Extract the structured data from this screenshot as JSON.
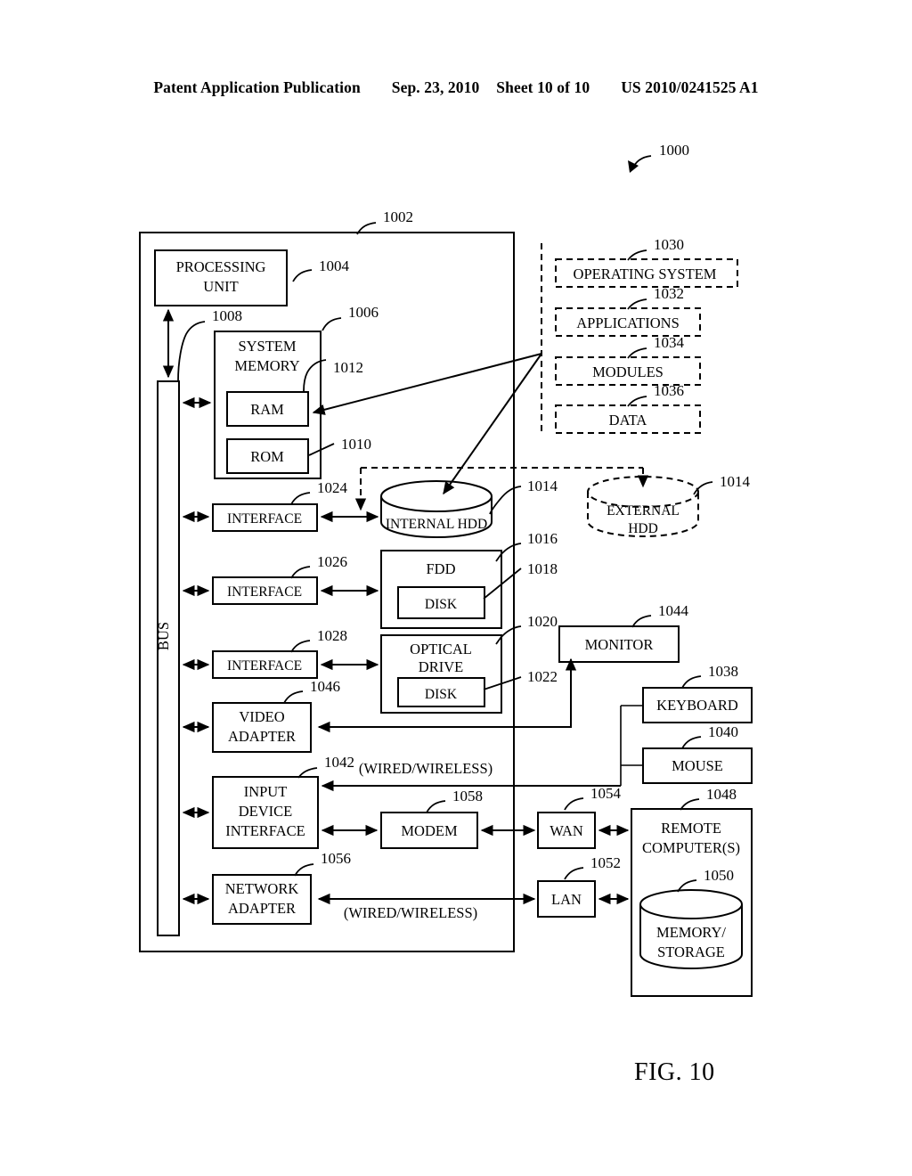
{
  "header": {
    "publication": "Patent Application Publication",
    "date": "Sep. 23, 2010",
    "sheet": "Sheet 10 of 10",
    "patent_number": "US 2010/0241525 A1"
  },
  "figure": {
    "caption": "FIG. 10",
    "system_ref": "1000"
  },
  "blocks": {
    "computer": {
      "ref": "1002"
    },
    "processing_unit": {
      "label_line1": "PROCESSING",
      "label_line2": "UNIT",
      "ref": "1004"
    },
    "system_memory": {
      "label_line1": "SYSTEM",
      "label_line2": "MEMORY",
      "ref": "1006"
    },
    "bus": {
      "label": "BUS",
      "ref": "1008"
    },
    "rom": {
      "label": "ROM",
      "ref": "1010"
    },
    "ram": {
      "label": "RAM",
      "ref": "1012"
    },
    "internal_hdd": {
      "label": "INTERNAL HDD",
      "ref": "1014"
    },
    "external_hdd": {
      "label_line1": "EXTERNAL",
      "label_line2": "HDD",
      "ref": "1014"
    },
    "fdd": {
      "label": "FDD",
      "ref": "1016"
    },
    "fdd_disk": {
      "label": "DISK",
      "ref": "1018"
    },
    "optical_drive": {
      "label_line1": "OPTICAL",
      "label_line2": "DRIVE",
      "ref": "1020"
    },
    "optical_disk": {
      "label": "DISK",
      "ref": "1022"
    },
    "interface_hdd": {
      "label": "INTERFACE",
      "ref": "1024"
    },
    "interface_fdd": {
      "label": "INTERFACE",
      "ref": "1026"
    },
    "interface_optical": {
      "label": "INTERFACE",
      "ref": "1028"
    },
    "operating_system": {
      "label": "OPERATING SYSTEM",
      "ref": "1030"
    },
    "applications": {
      "label": "APPLICATIONS",
      "ref": "1032"
    },
    "modules": {
      "label": "MODULES",
      "ref": "1034"
    },
    "data": {
      "label": "DATA",
      "ref": "1036"
    },
    "keyboard": {
      "label": "KEYBOARD",
      "ref": "1038"
    },
    "mouse": {
      "label": "MOUSE",
      "ref": "1040"
    },
    "input_device_interface": {
      "label_line1": "INPUT",
      "label_line2": "DEVICE",
      "label_line3": "INTERFACE",
      "ref": "1042"
    },
    "monitor": {
      "label": "MONITOR",
      "ref": "1044"
    },
    "video_adapter": {
      "label_line1": "VIDEO",
      "label_line2": "ADAPTER",
      "ref": "1046"
    },
    "remote_computers": {
      "label_line1": "REMOTE",
      "label_line2": "COMPUTER(S)",
      "ref": "1048"
    },
    "memory_storage": {
      "label_line1": "MEMORY/",
      "label_line2": "STORAGE",
      "ref": "1050"
    },
    "lan": {
      "label": "LAN",
      "ref": "1052"
    },
    "wan": {
      "label": "WAN",
      "ref": "1054"
    },
    "network_adapter": {
      "label_line1": "NETWORK",
      "label_line2": "ADAPTER",
      "ref": "1056"
    },
    "modem": {
      "label": "MODEM",
      "ref": "1058"
    }
  },
  "annotations": {
    "wired_wireless_top": "(WIRED/WIRELESS)",
    "wired_wireless_bottom": "(WIRED/WIRELESS)"
  },
  "colors": {
    "ink": "#000000",
    "paper": "#ffffff"
  }
}
